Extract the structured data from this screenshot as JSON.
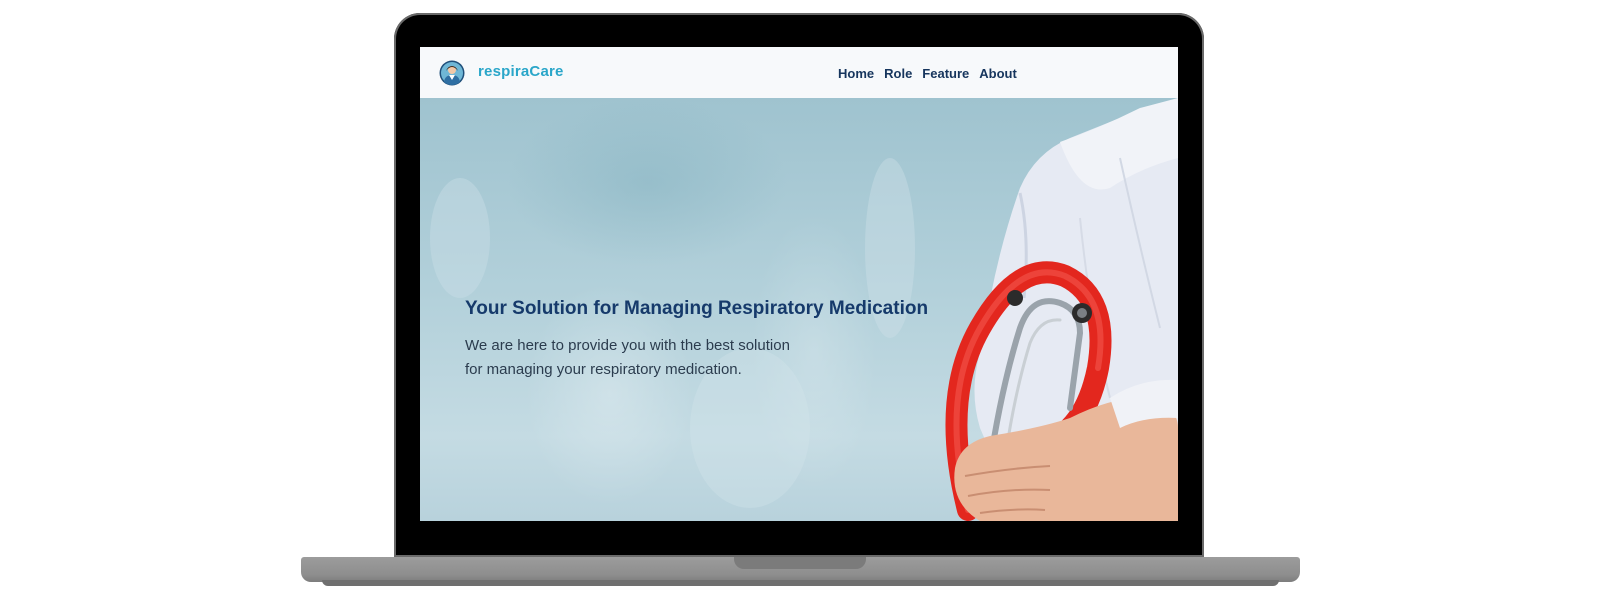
{
  "app": {
    "brand_name": "respiraCare",
    "logo_icon": "doctor-avatar-icon"
  },
  "nav": {
    "items": [
      {
        "label": "Home"
      },
      {
        "label": "Role"
      },
      {
        "label": "Feature"
      },
      {
        "label": "About"
      }
    ]
  },
  "hero": {
    "title": "Your Solution for Managing Respiratory Medication",
    "text": "We are here to provide you with the best solution for managing your respiratory medication.",
    "image": "doctor-holding-stethoscope-photo"
  },
  "colors": {
    "brand": "#2aa6c9",
    "nav_text": "#16355d",
    "title": "#163a6b",
    "stethoscope": "#e3271e"
  }
}
